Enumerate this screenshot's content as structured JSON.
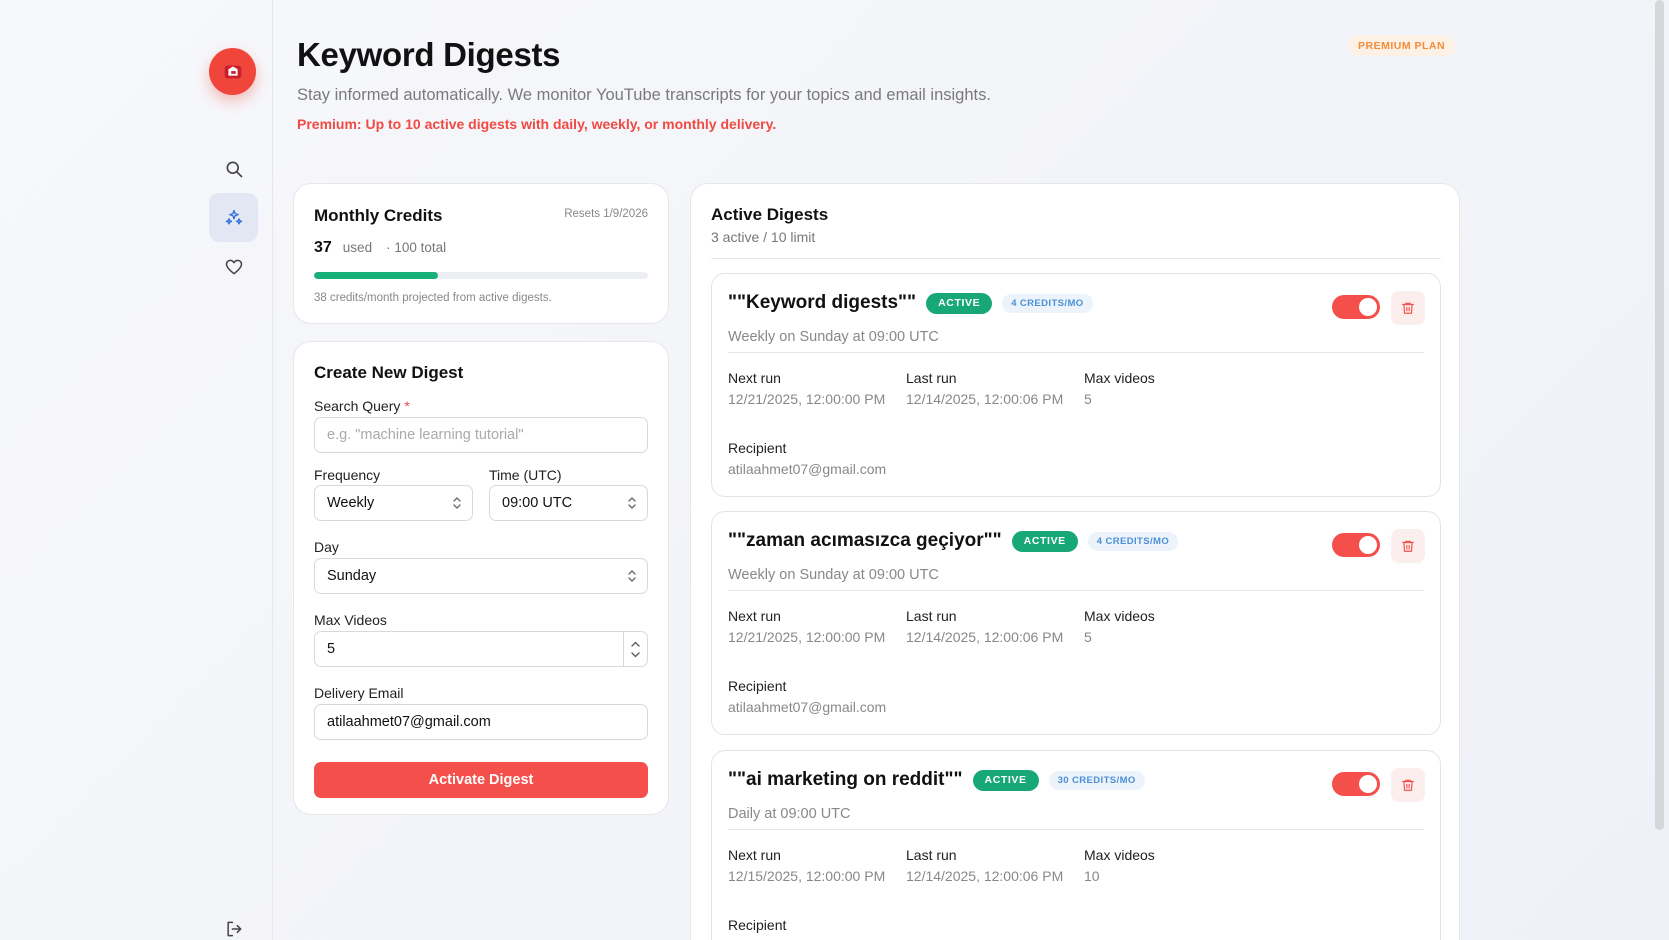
{
  "header": {
    "title": "Keyword Digests",
    "subtitle": "Stay informed automatically. We monitor YouTube transcripts for your topics and email insights.",
    "premium_note": "Premium: Up to 10 active digests with daily, weekly, or monthly delivery.",
    "plan_badge": "PREMIUM PLAN"
  },
  "credits": {
    "title": "Monthly Credits",
    "resets": "Resets 1/9/2026",
    "used": "37",
    "used_label": "used",
    "total_label": "· 100 total",
    "used_fraction": 0.37,
    "projected": "38 credits/month projected from active digests."
  },
  "form": {
    "title": "Create New Digest",
    "query_label": "Search Query",
    "query_required": "*",
    "query_placeholder": "e.g. \"machine learning tutorial\"",
    "frequency_label": "Frequency",
    "frequency_value": "Weekly",
    "time_label": "Time (UTC)",
    "time_value": "09:00 UTC",
    "day_label": "Day",
    "day_value": "Sunday",
    "max_videos_label": "Max Videos",
    "max_videos_value": "5",
    "email_label": "Delivery Email",
    "email_value": "atilaahmet07@gmail.com",
    "submit_label": "Activate Digest"
  },
  "digests": {
    "title": "Active Digests",
    "count": "3 active / 10 limit",
    "labels": {
      "next_run": "Next run",
      "last_run": "Last run",
      "max_videos": "Max videos",
      "recipient": "Recipient"
    },
    "items": [
      {
        "name": "\"\"Keyword digests\"\"",
        "status": "ACTIVE",
        "credits": "4 CREDITS/MO",
        "schedule": "Weekly on Sunday at 09:00 UTC",
        "next_run": "12/21/2025, 12:00:00 PM",
        "last_run": "12/14/2025, 12:00:06 PM",
        "max_videos": "5",
        "recipient": "atilaahmet07@gmail.com"
      },
      {
        "name": "\"\"zaman acımasızca geçiyor\"\"",
        "status": "ACTIVE",
        "credits": "4 CREDITS/MO",
        "schedule": "Weekly on Sunday at 09:00 UTC",
        "next_run": "12/21/2025, 12:00:00 PM",
        "last_run": "12/14/2025, 12:00:06 PM",
        "max_videos": "5",
        "recipient": "atilaahmet07@gmail.com"
      },
      {
        "name": "\"\"ai marketing on reddit\"\"",
        "status": "ACTIVE",
        "credits": "30 CREDITS/MO",
        "schedule": "Daily at 09:00 UTC",
        "next_run": "12/15/2025, 12:00:00 PM",
        "last_run": "12/14/2025, 12:00:06 PM",
        "max_videos": "10",
        "recipient": ""
      }
    ]
  },
  "colors": {
    "accent": "#f44f4a",
    "success": "#18a877",
    "plan_badge": "#f28d3a"
  },
  "icons": [
    "logo-icon",
    "search-icon",
    "sparkles-icon",
    "heart-icon",
    "logout-icon",
    "trash-icon"
  ]
}
